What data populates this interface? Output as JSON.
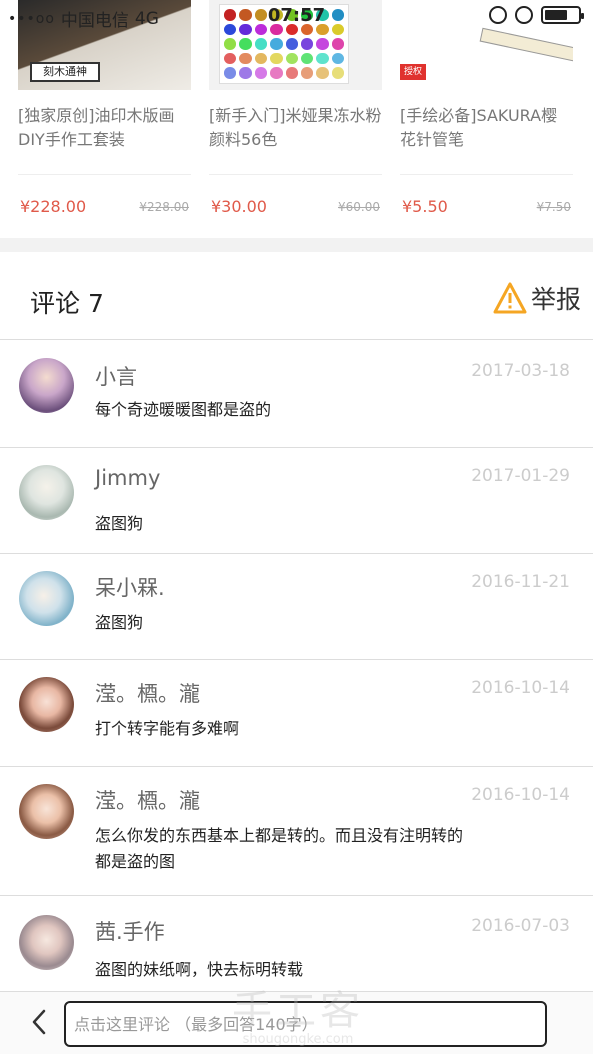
{
  "status_bar": {
    "signal_dots": "•••oo",
    "carrier": "中国电信",
    "network": "4G",
    "time": "07:57"
  },
  "products": [
    {
      "title": "[独家原创]油印木版画DIY手作工套装",
      "price": "¥228.00",
      "original_price": "¥228.00",
      "image_text": "刻木通神",
      "image_icon": "woodprint-image"
    },
    {
      "title": "[新手入门]米娅果冻水粉颜料56色",
      "price": "¥30.00",
      "original_price": "¥60.00",
      "image_icon": "paint-swatches-image"
    },
    {
      "title": "[手绘必备]SAKURA樱花针管笔",
      "price": "¥5.50",
      "original_price": "¥7.50",
      "image_text": "授权",
      "image_icon": "pen-image"
    }
  ],
  "comments_section": {
    "title": "评论 7",
    "report_label": "举报"
  },
  "comments": [
    {
      "name": "小言",
      "date": "2017-03-18",
      "text": "每个奇迹暖暖图都是盗的"
    },
    {
      "name": "Jimmy",
      "date": "2017-01-29",
      "text": " 盗图狗"
    },
    {
      "name": "呆小槑.",
      "date": "2016-11-21",
      "text": "盗图狗"
    },
    {
      "name": "滢。槱。瀧",
      "date": "2016-10-14",
      "text": "打个转字能有多难啊"
    },
    {
      "name": "滢。槱。瀧",
      "date": "2016-10-14",
      "text": "怎么你发的东西基本上都是转的。而且没有注明转的都是盗的图"
    },
    {
      "name": "茜.手作",
      "date": "2016-07-03",
      "text": "盗图的妹纸啊，快去标明转载"
    }
  ],
  "bottom_bar": {
    "input_placeholder": "点击这里评论 （最多回答140字）"
  },
  "watermark": {
    "main": "手工客",
    "sub": "shougongke.com"
  },
  "colors": {
    "price": "#e05a4a",
    "warning": "#f5a623",
    "date": "#cccccc",
    "divider": "#dddddd"
  }
}
